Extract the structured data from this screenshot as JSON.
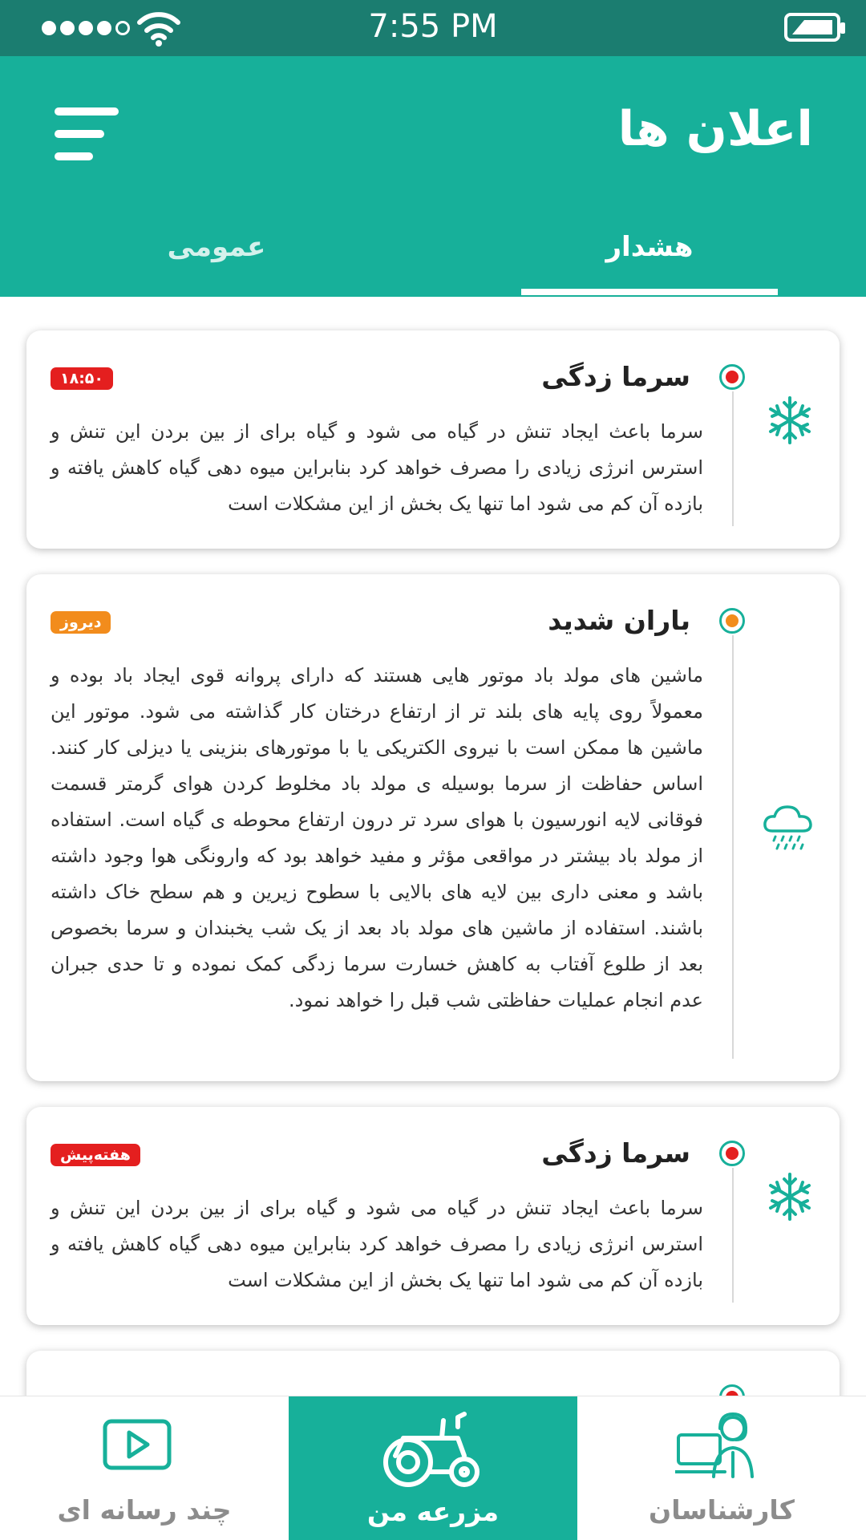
{
  "status_bar": {
    "time": "7:55 PM"
  },
  "header": {
    "title": "اعلان ها",
    "menu_icon": "hamburger-menu-icon"
  },
  "tabs": [
    {
      "label": "هشدار",
      "active": true
    },
    {
      "label": "عمومی",
      "active": false
    }
  ],
  "colors": {
    "primary": "#17b09a",
    "status_bar": "#1b7d70",
    "badge_red": "#e41f1f",
    "badge_orange": "#f28c1c"
  },
  "notifications": [
    {
      "title": "سرما زدگی",
      "badge": "۱۸:۵۰",
      "badge_color": "#e41f1f",
      "icon": "snowflake-icon",
      "body": "سرما باعث ایجاد تنش در گیاه می شود و گیاه برای از بین بردن این تنش و استرس انرژی زیادی را مصرف خواهد کرد  بنابراین میوه دهی گیاه کاهش یافته و بازده آن کم می شود اما تنها یک بخش از این مشکلات است"
    },
    {
      "title": "باران شدید",
      "badge": "دیروز",
      "badge_color": "#f28c1c",
      "icon": "rain-cloud-icon",
      "body": "ماشین های مولد باد موتور هایی هستند که دارای پروانه قوی ایجاد باد بوده و معمولاً روی پایه های بلند تر از ارتفاع درختان کار گذاشته می شود. موتور این ماشین ها ممکن است با نیروی الکتریکی یا با موتورهای بنزینی یا دیزلی کار کنند. اساس حفاظت از سرما بوسیله ی مولد باد مخلوط کردن هوای گرمتر قسمت فوقانی لایه انورسیون با هوای سرد تر درون ارتفاع محوطه ی گیاه است. استفاده از مولد باد بیشتر در مواقعی مؤثر و مفید خواهد بود که وارونگی هوا وجود داشته باشد و معنی داری بین لایه های بالایی با سطوح زیرین و هم سطح خاک داشته باشند. استفاده از ماشین های مولد باد بعد از یک شب یخبندان و سرما بخصوص بعد از طلوع آفتاب به کاهش خسارت سرما زدگی کمک نموده و تا حدی جبران عدم انجام عملیات حفاظتی شب قبل را خواهد نمود."
    },
    {
      "title": "سرما زدگی",
      "badge": "هفته‌پیش",
      "badge_color": "#e41f1f",
      "icon": "snowflake-icon",
      "body": "سرما باعث ایجاد تنش در گیاه می شود و گیاه برای از بین بردن این تنش و استرس انرژی زیادی را مصرف خواهد کرد  بنابراین میوه دهی گیاه کاهش یافته و بازده آن کم می شود اما تنها یک بخش از این مشکلات است"
    }
  ],
  "bottom_nav": [
    {
      "label": "چند رسانه ای",
      "icon": "video-play-icon",
      "active": false
    },
    {
      "label": "مزرعه من",
      "icon": "tractor-icon",
      "active": true
    },
    {
      "label": "کارشناسان",
      "icon": "expert-headset-icon",
      "active": false
    }
  ]
}
